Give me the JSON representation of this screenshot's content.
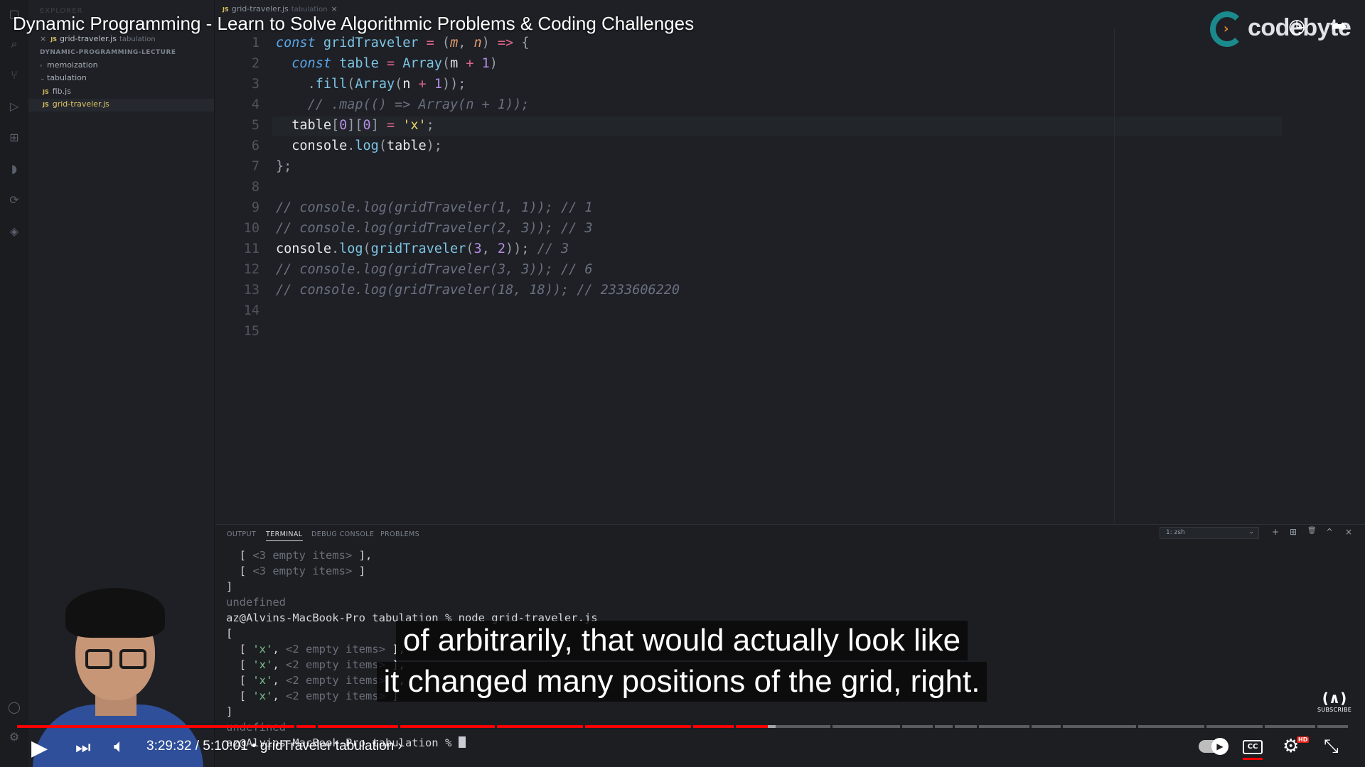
{
  "video": {
    "title": "Dynamic Programming - Learn to Solve Algorithmic Problems & Coding Challenges",
    "channel_logo_text": "codebyte",
    "captions": [
      "of arbitrarily, that would actually look like",
      "it changed many positions of the grid, right."
    ],
    "current_time": "3:29:32",
    "separator": "/",
    "duration": "5:10:01",
    "chapter": "• gridTraveler tabulation ›",
    "progress_fraction": 0.564,
    "loaded_fraction": 0.57,
    "subscribe_label": "SUBSCRIBE",
    "subscribe_mark": "(∧)",
    "hd_badge": "HD",
    "colors": {
      "played": "#ff0000",
      "caption_bg": "#080808"
    }
  },
  "sidebar": {
    "header": "EXPLORER",
    "open_editor": {
      "name": "grid-traveler.js",
      "folder": "tabulation"
    },
    "section": "DYNAMIC-PROGRAMMING-LECTURE",
    "items": [
      {
        "chev": "›",
        "label": "memoization"
      },
      {
        "chev": "⌄",
        "label": "tabulation"
      },
      {
        "label": "fib.js"
      },
      {
        "label": "grid-traveler.js"
      }
    ]
  },
  "editor": {
    "tab": {
      "name": "grid-traveler.js",
      "folder": "tabulation",
      "close": "×"
    },
    "line_numbers": [
      "1",
      "2",
      "3",
      "4",
      "5",
      "6",
      "7",
      "8",
      "9",
      "10",
      "11",
      "12",
      "13",
      "14",
      "15"
    ]
  },
  "panel": {
    "tabs": [
      "OUTPUT",
      "TERMINAL",
      "DEBUG CONSOLE",
      "PROBLEMS"
    ],
    "terminal_select": "1: zsh",
    "tools": [
      "+",
      "⊞",
      "🗑",
      "^",
      "×"
    ],
    "prompt": "az@Alvins-MacBook-Pro tabulation % node grid-traveler.js",
    "prompt2": "az@Alvins-MacBook-Pro tabulation % ",
    "undefined_text": "undefined",
    "empty3": "<3 empty items>",
    "empty2": "<2 empty items>",
    "x": "'x'"
  },
  "icons": [
    "files-icon",
    "search-icon",
    "source-control-icon",
    "run-icon",
    "extensions-icon",
    "docker-icon",
    "remote-icon",
    "git-icon",
    "account-icon",
    "settings-icon"
  ]
}
